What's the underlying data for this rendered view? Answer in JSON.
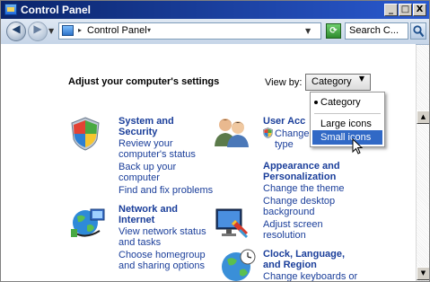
{
  "window": {
    "title": "Control Panel"
  },
  "titlebar_buttons": {
    "minimize": "_",
    "maximize": "□",
    "close": "X"
  },
  "toolbar": {
    "back_icon": "back-arrow-icon",
    "forward_icon": "forward-arrow-icon",
    "breadcrumb": "Control Panel",
    "search_placeholder": "Search C..."
  },
  "main": {
    "heading": "Adjust your computer's settings",
    "view_by_label": "View by:",
    "view_by_value": "Category"
  },
  "view_menu": {
    "items": [
      "Category",
      "Large icons",
      "Small icons"
    ],
    "checked": "Category",
    "highlighted": "Small icons"
  },
  "categories": [
    {
      "title_1": "System and",
      "title_2": "Security",
      "links": [
        "Review your",
        "computer's status",
        "Back up your",
        "computer",
        "Find and fix problems"
      ]
    },
    {
      "title_1": "Network and",
      "title_2": "Internet",
      "links": [
        "View network status",
        "and tasks",
        "Choose homegroup",
        "and sharing options"
      ]
    },
    {
      "title_1": "User Acc",
      "links": [
        "Change",
        "type"
      ]
    },
    {
      "title_1": "Appearance and",
      "title_2": "Personalization",
      "links": [
        "Change the theme",
        "Change desktop",
        "background",
        "Adjust screen",
        "resolution"
      ]
    },
    {
      "title_1": "Clock, Language,",
      "title_2": "and Region",
      "links": [
        "Change keyboards or"
      ]
    }
  ],
  "colors": {
    "link": "#1a3e9a",
    "titlebar": "#0a246a",
    "menu_highlight": "#3169c6"
  }
}
